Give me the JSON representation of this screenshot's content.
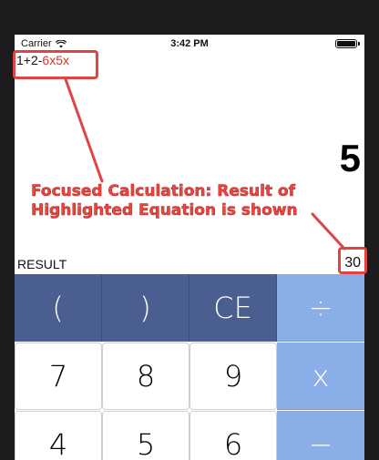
{
  "status_bar": {
    "carrier": "Carrier",
    "time": "3:42 PM"
  },
  "display": {
    "expression_prefix": "1+2-",
    "expression_highlight": "6x5x",
    "main_value": "5",
    "result_label": "RESULT",
    "result_value": "30"
  },
  "keypad": {
    "row1": [
      "(",
      ")",
      "CE",
      "÷"
    ],
    "row2": [
      "7",
      "8",
      "9",
      "x"
    ],
    "row3": [
      "4",
      "5",
      "6",
      "−"
    ]
  },
  "annotation": {
    "line1": "Focused Calculation: Result of",
    "line2": "Highlighted Equation  is shown",
    "color": "#e04545"
  },
  "colors": {
    "paren_key": "#4a5f8f",
    "operator_key": "#89aee8",
    "highlight_text": "#d9342b"
  }
}
